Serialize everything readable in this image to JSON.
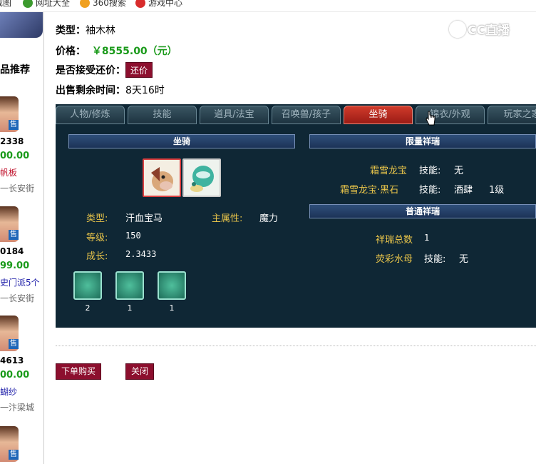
{
  "bookmarks": [
    {
      "label": "截图",
      "color": "#e8a317",
      "icon": "bookmark-icon"
    },
    {
      "label": "网址大全",
      "color": "#3c9a2e",
      "icon": "site-directory-icon"
    },
    {
      "label": "360搜索",
      "color": "#f0a020",
      "icon": "search-360-icon"
    },
    {
      "label": "游戏中心",
      "color": "#d82c2c",
      "icon": "game-center-icon"
    }
  ],
  "watermark": "CC直播",
  "sidebar": {
    "heading": "品推荐",
    "items": [
      {
        "code": "2338",
        "price": "00.00",
        "name": "帆板",
        "server": "一长安街",
        "name_color": "#c0122c"
      },
      {
        "code": "0184",
        "price": "99.00",
        "name": "史门派5个",
        "server": "一长安街",
        "name_color": "#2222aa"
      },
      {
        "code": "4613",
        "price": "00.00",
        "name": "蝴纱",
        "server": "一汴梁城",
        "name_color": "#2222aa"
      }
    ],
    "slot_label": "售"
  },
  "detail": {
    "type_label": "类型：",
    "type_value": "袖木林",
    "price_label": "价格：",
    "price_value": "￥8555.00（元）",
    "bargain_label": "是否接受还价：",
    "bargain_button": "还价",
    "remaining_label": "出售剩余时间：",
    "remaining_value": "8天16时"
  },
  "tabs": [
    {
      "label": "人物/修炼"
    },
    {
      "label": "技能"
    },
    {
      "label": "道具/法宝"
    },
    {
      "label": "召唤兽/孩子"
    },
    {
      "label": "坐骑",
      "active": true
    },
    {
      "label": "锦衣/外观"
    },
    {
      "label": "玩家之家"
    }
  ],
  "mount": {
    "section_title": "坐骑",
    "type_label": "类型:",
    "type_value": "汗血宝马",
    "attr_label": "主属性:",
    "attr_value": "魔力",
    "level_label": "等级:",
    "level_value": "150",
    "growth_label": "成长:",
    "growth_value": "2.3433",
    "skills": [
      {
        "count": "2",
        "icon": "mount-skill-icon"
      },
      {
        "count": "1",
        "icon": "mount-skill-icon"
      },
      {
        "count": "1",
        "icon": "mount-skill-icon"
      }
    ]
  },
  "limited": {
    "section_title": "限量祥瑞",
    "rows": [
      {
        "name": "霜雪龙宝",
        "skill_label": "技能:",
        "skill": "无",
        "extra": ""
      },
      {
        "name": "霜雪龙宝·黑石",
        "skill_label": "技能:",
        "skill": "酒肆",
        "extra": "1级"
      }
    ]
  },
  "common": {
    "section_title": "普通祥瑞",
    "total_label": "祥瑞总数",
    "total_value": "1",
    "rows": [
      {
        "name": "荧彩水母",
        "skill_label": "技能:",
        "skill": "无"
      }
    ]
  },
  "actions": {
    "buy": "下单购买",
    "close": "关闭"
  },
  "colors": {
    "panel_bg": "#0f2735",
    "accent_red": "#8c0f2e",
    "price_green": "#1a9a1a",
    "label_gold": "#e8c44a"
  }
}
